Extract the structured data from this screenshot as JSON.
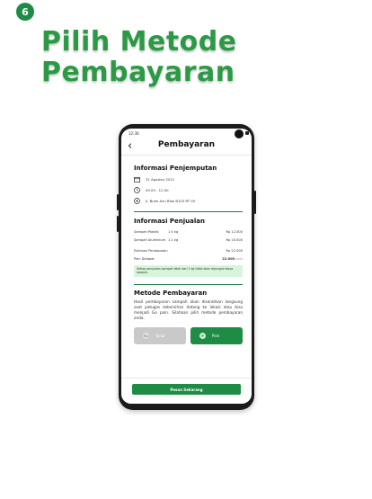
{
  "step": {
    "number": "6"
  },
  "headline": {
    "line1": "Pilih Metode",
    "line2": "Pembayaran"
  },
  "colors": {
    "brand_green": "#1e8c45",
    "headline_green": "#2a9a44",
    "note_bg": "#d6f5d9",
    "disabled_gray": "#c9c9c9"
  },
  "status_bar": {
    "time": "12:30"
  },
  "app_bar": {
    "title": "Pembayaran",
    "back_icon": "chevron-left"
  },
  "pickup": {
    "title": "Informasi Penjemputan",
    "date": {
      "icon": "calendar",
      "text": "31 Agustus 2021"
    },
    "time": {
      "icon": "clock",
      "text": "09.00 - 12.00"
    },
    "address": {
      "icon": "location-pin",
      "text": "Jl. Bumi Asri Blok B103 RT 05"
    }
  },
  "sale": {
    "title": "Informasi Penjualan",
    "items": [
      {
        "name": "Sampah Plastik",
        "qty": "1    4 kg",
        "price": "Rp 12.000"
      },
      {
        "name": "Sampah Aluminium",
        "qty": "1    2 kg",
        "price": "Rp 10.000"
      }
    ],
    "estimate": {
      "label": "Estimasi Pendapatan",
      "value": "Rp 22.000"
    },
    "points": {
      "label": "Poin Didapat",
      "value": "22.000",
      "unit": "poin"
    },
    "note": "Setiap penjualan sampah lebih dari 1 kg tidak akan dipungut biaya apapun."
  },
  "payment": {
    "title": "Metode Pembayaran",
    "description": "Hasil pembayaran sampah akan diserahkan langsung saat petugas kebersihan datang ke lokasi atau bisa menjadi Go poin. Silahkan pilih metode pembayaran anda.",
    "options": [
      {
        "label": "Tunai",
        "icon": "cash",
        "badge": "Rp",
        "selected": false
      },
      {
        "label": "Poin",
        "icon": "coin",
        "badge": "P",
        "selected": true
      }
    ]
  },
  "cta": {
    "label": "Pesan Sekarang"
  }
}
